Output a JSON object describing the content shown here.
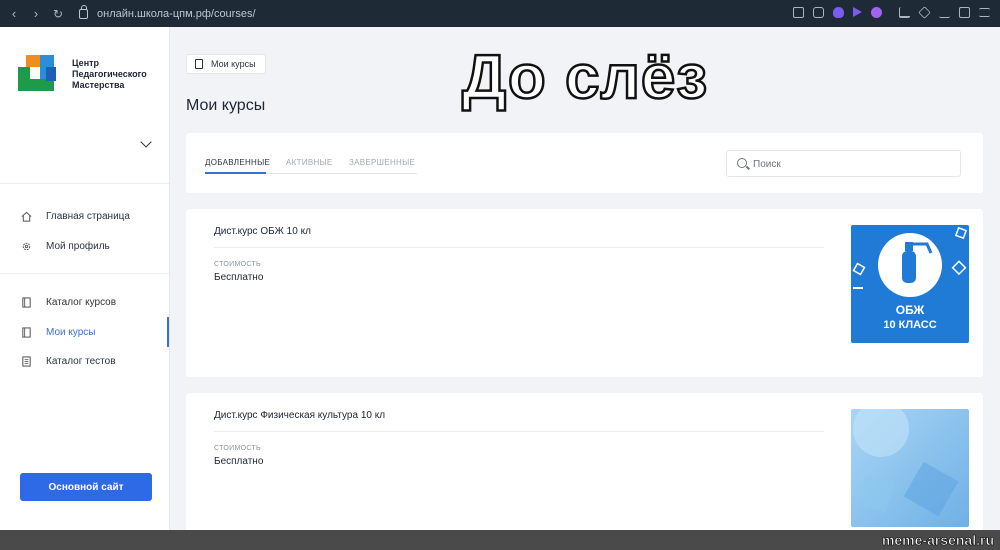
{
  "browser": {
    "url": "онлайн.школа-цпм.рф/courses/",
    "back": "‹",
    "forward": "›",
    "reload": "↻"
  },
  "brand": {
    "name_line1": "Центр",
    "name_line2": "Педагогического",
    "name_line3": "Мастерства"
  },
  "sidebar": {
    "items": [
      {
        "label": "Главная страница",
        "icon": "home-icon"
      },
      {
        "label": "Мой профиль",
        "icon": "gear-icon"
      },
      {
        "label": "Каталог курсов",
        "icon": "book-icon"
      },
      {
        "label": "Мои курсы",
        "icon": "book-icon",
        "active": true
      },
      {
        "label": "Каталог тестов",
        "icon": "document-icon"
      }
    ],
    "main_button": "Основной сайт"
  },
  "breadcrumb": {
    "label": "Мои курсы"
  },
  "page": {
    "title": "Мои курсы"
  },
  "meme": {
    "caption": "До слёз"
  },
  "tabs": [
    {
      "label": "ДОБАВЛЕННЫЕ",
      "active": true
    },
    {
      "label": "АКТИВНЫЕ",
      "active": false
    },
    {
      "label": "ЗАВЕРШЕННЫЕ",
      "active": false
    }
  ],
  "search": {
    "placeholder": "Поиск",
    "value": ""
  },
  "courses": [
    {
      "name": "Дист.курс ОБЖ 10 кл",
      "price_label": "СТОИМОСТЬ",
      "price": "Бесплатно",
      "thumb_line1": "ОБЖ",
      "thumb_line2": "10 КЛАСС",
      "thumb_color": "#1f7bd6"
    },
    {
      "name": "Дист.курс Физическая культура 10 кл",
      "price_label": "СТОИМОСТЬ",
      "price": "Бесплатно",
      "thumb_color": "#8fc6ec"
    }
  ],
  "watermark": "meme-arsenal.ru",
  "colors": {
    "accent": "#2f6ae6",
    "active_nav": "#3b6fd8",
    "page_bg": "#f2f3f7",
    "browser_bar": "#1e2a36"
  }
}
